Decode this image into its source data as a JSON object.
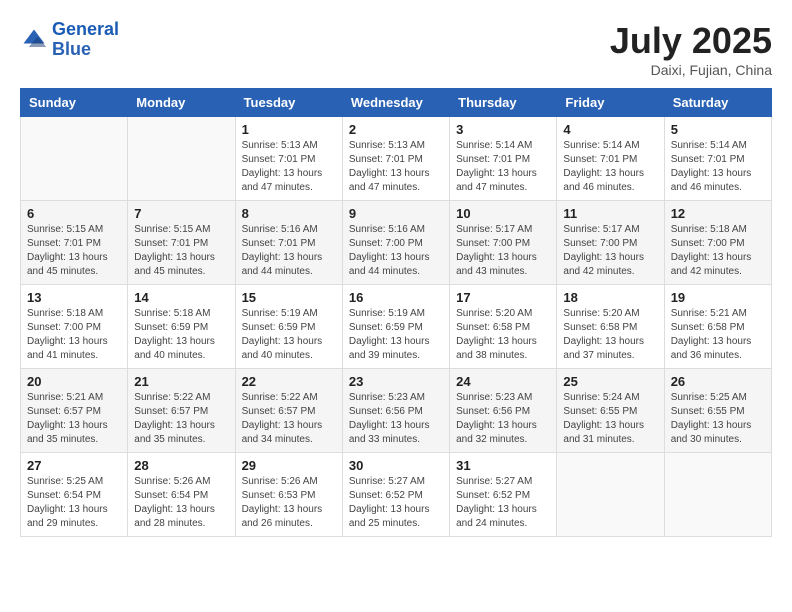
{
  "header": {
    "logo_line1": "General",
    "logo_line2": "Blue",
    "month": "July 2025",
    "location": "Daixi, Fujian, China"
  },
  "weekdays": [
    "Sunday",
    "Monday",
    "Tuesday",
    "Wednesday",
    "Thursday",
    "Friday",
    "Saturday"
  ],
  "weeks": [
    [
      {
        "day": "",
        "sunrise": "",
        "sunset": "",
        "daylight": ""
      },
      {
        "day": "",
        "sunrise": "",
        "sunset": "",
        "daylight": ""
      },
      {
        "day": "1",
        "sunrise": "Sunrise: 5:13 AM",
        "sunset": "Sunset: 7:01 PM",
        "daylight": "Daylight: 13 hours and 47 minutes."
      },
      {
        "day": "2",
        "sunrise": "Sunrise: 5:13 AM",
        "sunset": "Sunset: 7:01 PM",
        "daylight": "Daylight: 13 hours and 47 minutes."
      },
      {
        "day": "3",
        "sunrise": "Sunrise: 5:14 AM",
        "sunset": "Sunset: 7:01 PM",
        "daylight": "Daylight: 13 hours and 47 minutes."
      },
      {
        "day": "4",
        "sunrise": "Sunrise: 5:14 AM",
        "sunset": "Sunset: 7:01 PM",
        "daylight": "Daylight: 13 hours and 46 minutes."
      },
      {
        "day": "5",
        "sunrise": "Sunrise: 5:14 AM",
        "sunset": "Sunset: 7:01 PM",
        "daylight": "Daylight: 13 hours and 46 minutes."
      }
    ],
    [
      {
        "day": "6",
        "sunrise": "Sunrise: 5:15 AM",
        "sunset": "Sunset: 7:01 PM",
        "daylight": "Daylight: 13 hours and 45 minutes."
      },
      {
        "day": "7",
        "sunrise": "Sunrise: 5:15 AM",
        "sunset": "Sunset: 7:01 PM",
        "daylight": "Daylight: 13 hours and 45 minutes."
      },
      {
        "day": "8",
        "sunrise": "Sunrise: 5:16 AM",
        "sunset": "Sunset: 7:01 PM",
        "daylight": "Daylight: 13 hours and 44 minutes."
      },
      {
        "day": "9",
        "sunrise": "Sunrise: 5:16 AM",
        "sunset": "Sunset: 7:00 PM",
        "daylight": "Daylight: 13 hours and 44 minutes."
      },
      {
        "day": "10",
        "sunrise": "Sunrise: 5:17 AM",
        "sunset": "Sunset: 7:00 PM",
        "daylight": "Daylight: 13 hours and 43 minutes."
      },
      {
        "day": "11",
        "sunrise": "Sunrise: 5:17 AM",
        "sunset": "Sunset: 7:00 PM",
        "daylight": "Daylight: 13 hours and 42 minutes."
      },
      {
        "day": "12",
        "sunrise": "Sunrise: 5:18 AM",
        "sunset": "Sunset: 7:00 PM",
        "daylight": "Daylight: 13 hours and 42 minutes."
      }
    ],
    [
      {
        "day": "13",
        "sunrise": "Sunrise: 5:18 AM",
        "sunset": "Sunset: 7:00 PM",
        "daylight": "Daylight: 13 hours and 41 minutes."
      },
      {
        "day": "14",
        "sunrise": "Sunrise: 5:18 AM",
        "sunset": "Sunset: 6:59 PM",
        "daylight": "Daylight: 13 hours and 40 minutes."
      },
      {
        "day": "15",
        "sunrise": "Sunrise: 5:19 AM",
        "sunset": "Sunset: 6:59 PM",
        "daylight": "Daylight: 13 hours and 40 minutes."
      },
      {
        "day": "16",
        "sunrise": "Sunrise: 5:19 AM",
        "sunset": "Sunset: 6:59 PM",
        "daylight": "Daylight: 13 hours and 39 minutes."
      },
      {
        "day": "17",
        "sunrise": "Sunrise: 5:20 AM",
        "sunset": "Sunset: 6:58 PM",
        "daylight": "Daylight: 13 hours and 38 minutes."
      },
      {
        "day": "18",
        "sunrise": "Sunrise: 5:20 AM",
        "sunset": "Sunset: 6:58 PM",
        "daylight": "Daylight: 13 hours and 37 minutes."
      },
      {
        "day": "19",
        "sunrise": "Sunrise: 5:21 AM",
        "sunset": "Sunset: 6:58 PM",
        "daylight": "Daylight: 13 hours and 36 minutes."
      }
    ],
    [
      {
        "day": "20",
        "sunrise": "Sunrise: 5:21 AM",
        "sunset": "Sunset: 6:57 PM",
        "daylight": "Daylight: 13 hours and 35 minutes."
      },
      {
        "day": "21",
        "sunrise": "Sunrise: 5:22 AM",
        "sunset": "Sunset: 6:57 PM",
        "daylight": "Daylight: 13 hours and 35 minutes."
      },
      {
        "day": "22",
        "sunrise": "Sunrise: 5:22 AM",
        "sunset": "Sunset: 6:57 PM",
        "daylight": "Daylight: 13 hours and 34 minutes."
      },
      {
        "day": "23",
        "sunrise": "Sunrise: 5:23 AM",
        "sunset": "Sunset: 6:56 PM",
        "daylight": "Daylight: 13 hours and 33 minutes."
      },
      {
        "day": "24",
        "sunrise": "Sunrise: 5:23 AM",
        "sunset": "Sunset: 6:56 PM",
        "daylight": "Daylight: 13 hours and 32 minutes."
      },
      {
        "day": "25",
        "sunrise": "Sunrise: 5:24 AM",
        "sunset": "Sunset: 6:55 PM",
        "daylight": "Daylight: 13 hours and 31 minutes."
      },
      {
        "day": "26",
        "sunrise": "Sunrise: 5:25 AM",
        "sunset": "Sunset: 6:55 PM",
        "daylight": "Daylight: 13 hours and 30 minutes."
      }
    ],
    [
      {
        "day": "27",
        "sunrise": "Sunrise: 5:25 AM",
        "sunset": "Sunset: 6:54 PM",
        "daylight": "Daylight: 13 hours and 29 minutes."
      },
      {
        "day": "28",
        "sunrise": "Sunrise: 5:26 AM",
        "sunset": "Sunset: 6:54 PM",
        "daylight": "Daylight: 13 hours and 28 minutes."
      },
      {
        "day": "29",
        "sunrise": "Sunrise: 5:26 AM",
        "sunset": "Sunset: 6:53 PM",
        "daylight": "Daylight: 13 hours and 26 minutes."
      },
      {
        "day": "30",
        "sunrise": "Sunrise: 5:27 AM",
        "sunset": "Sunset: 6:52 PM",
        "daylight": "Daylight: 13 hours and 25 minutes."
      },
      {
        "day": "31",
        "sunrise": "Sunrise: 5:27 AM",
        "sunset": "Sunset: 6:52 PM",
        "daylight": "Daylight: 13 hours and 24 minutes."
      },
      {
        "day": "",
        "sunrise": "",
        "sunset": "",
        "daylight": ""
      },
      {
        "day": "",
        "sunrise": "",
        "sunset": "",
        "daylight": ""
      }
    ]
  ]
}
